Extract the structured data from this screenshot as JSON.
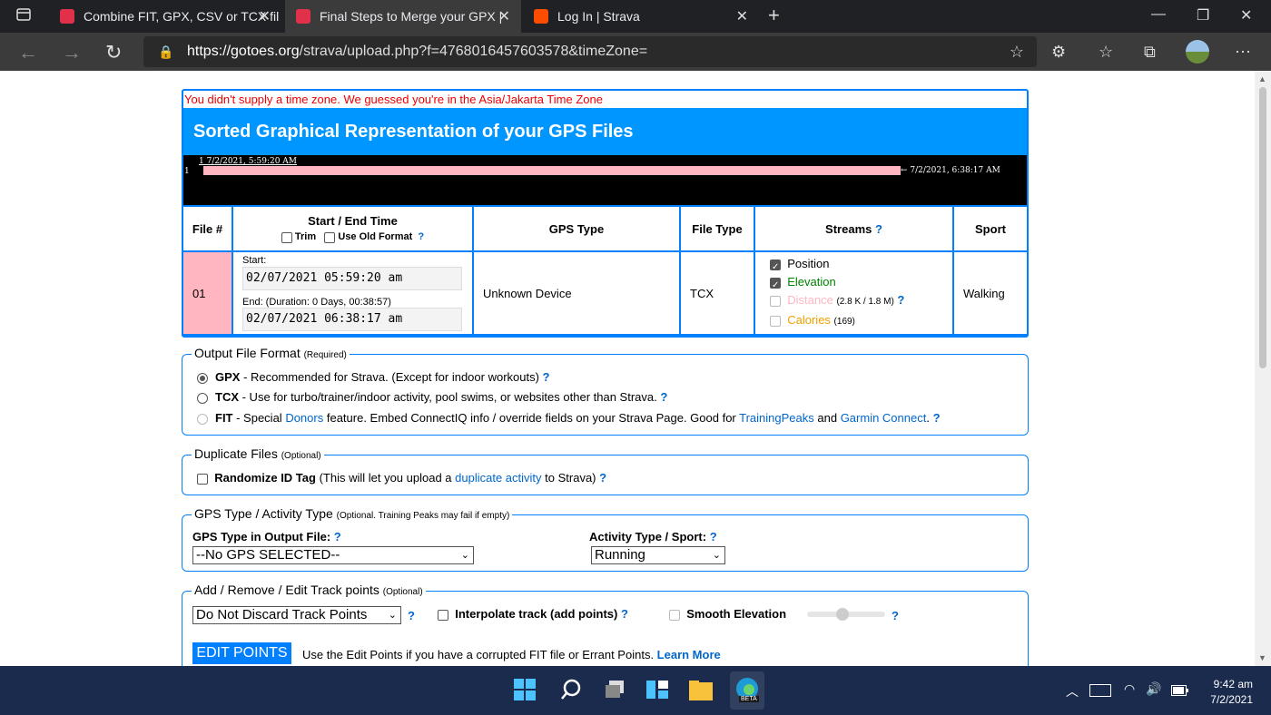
{
  "browser": {
    "tabs": [
      {
        "title": "Combine FIT, GPX, CSV or TCX fil",
        "favicon_color": "#e0304a"
      },
      {
        "title": "Final Steps to Merge your GPX |",
        "favicon_color": "#e0304a"
      },
      {
        "title": "Log In | Strava",
        "favicon_color": "#fc4c02"
      }
    ],
    "new_tab": "+",
    "url_host": "https://gotoes.org",
    "url_path": "/strava/upload.php?f=4768016457603578&timeZone="
  },
  "page": {
    "warning": "You didn't supply a time zone. We guessed you're in the Asia/Jakarta Time Zone",
    "header": "Sorted Graphical Representation of your GPS Files",
    "timeline": {
      "start_label": "1 7/2/2021, 5:59:20 AM",
      "row_label": "1",
      "end_label": "← 7/2/2021, 6:38:17 AM"
    },
    "table": {
      "headers": {
        "file_num": "File #",
        "start_end": "Start / End Time",
        "trim": "Trim",
        "use_old_format": "Use Old Format",
        "q": "?",
        "gps_type": "GPS Type",
        "file_type": "File Type",
        "streams": "Streams",
        "sport": "Sport"
      },
      "row": {
        "num": "01",
        "start_label": "Start:",
        "start_value": "02/07/2021 05:59:20 am",
        "end_label": "End: (Duration: 0 Days, 00:38:57)",
        "end_value": "02/07/2021 06:38:17 am",
        "gps_type": "Unknown Device",
        "file_type": "TCX",
        "streams": {
          "position": "Position",
          "elevation": "Elevation",
          "distance": "Distance",
          "distance_note": "(2.8 K / 1.8 M)",
          "calories": "Calories",
          "calories_note": "(169)"
        },
        "sport": "Walking"
      }
    },
    "output_format": {
      "legend": "Output File Format",
      "legend_note": "(Required)",
      "gpx_label": "GPX",
      "gpx_desc": " - Recommended for Strava. (Except for indoor workouts) ",
      "tcx_label": "TCX",
      "tcx_desc": " - Use for turbo/trainer/indoor activity, pool swims, or websites other than Strava. ",
      "fit_label": "FIT",
      "fit_desc1": " - Special ",
      "fit_link1": "Donors",
      "fit_desc2": " feature. Embed ConnectIQ info / override fields on your Strava Page. Good for ",
      "fit_link2": "TrainingPeaks",
      "fit_desc3": " and ",
      "fit_link3": "Garmin Connect",
      "fit_desc4": ". "
    },
    "duplicate": {
      "legend": "Duplicate Files",
      "legend_note": "(Optional)",
      "label": "Randomize ID Tag",
      "desc1": " (This will let you upload a ",
      "link": "duplicate activity",
      "desc2": " to Strava) "
    },
    "gps_activity": {
      "legend": "GPS Type / Activity Type",
      "legend_note": "(Optional. Training Peaks may fail if empty)",
      "gps_label": "GPS Type in Output File:",
      "gps_value": "--No GPS SELECTED--",
      "activity_label": "Activity Type / Sport:",
      "activity_value": "Running"
    },
    "track": {
      "legend": "Add / Remove / Edit Track points",
      "legend_note": "(Optional)",
      "select_value": "Do Not Discard Track Points",
      "interpolate": "Interpolate track (add points)",
      "smooth": "Smooth Elevation",
      "edit_button": "EDIT POINTS",
      "edit_desc": "Use the Edit Points if you have a corrupted FIT file or Errant Points. ",
      "learn_more": "Learn More"
    },
    "q": "?"
  },
  "taskbar": {
    "time": "9:42 am",
    "date": "7/2/2021",
    "edge_badge": "BETA"
  }
}
